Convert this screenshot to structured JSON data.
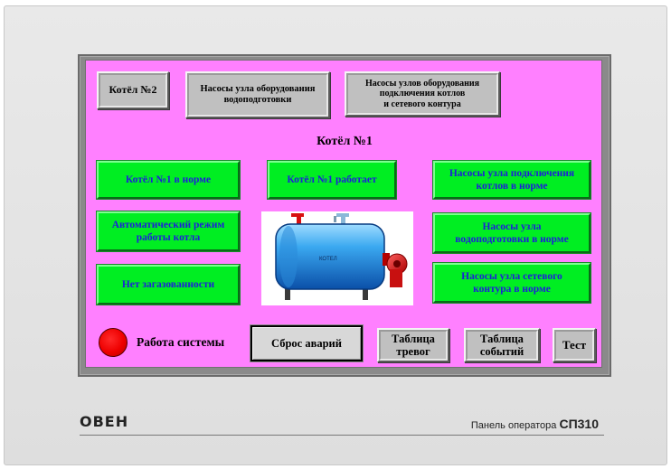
{
  "nav": {
    "boiler2": "Котёл №2",
    "water_prep_pumps": "Насосы узла оборудования\nводоподготовки",
    "connection_pumps": "Насосы узлов оборудования\nподключения котлов\nи сетевого контура"
  },
  "title": "Котёл №1",
  "status": {
    "boiler_ok": "Котёл №1  в норме",
    "boiler_running": "Котёл №1 работает",
    "connection_pumps_ok": "Насосы узла подключения\nкотлов в норме",
    "auto_mode": "Автоматический режим\nработы котла",
    "water_pumps_ok": "Насосы узла\nводоподготовки в норме",
    "no_gas": "Нет загазованности",
    "network_pumps_ok": "Насосы узла сетевого\nконтура в норме"
  },
  "boiler_label": "КОТЕЛ",
  "system": {
    "label": "Работа системы",
    "lamp_color": "#ee0000"
  },
  "buttons": {
    "reset": "Сброс аварий",
    "alarm_table": "Таблица\nтревог",
    "event_table": "Таблица\nсобытий",
    "test": "Тест"
  },
  "footer": {
    "logo": "ОВЕН",
    "caption": "Панель оператора",
    "model": "СП310"
  },
  "colors": {
    "screen_bg": "#ff80ff",
    "status_bg": "#00ee22",
    "status_text": "#1d20d8"
  }
}
